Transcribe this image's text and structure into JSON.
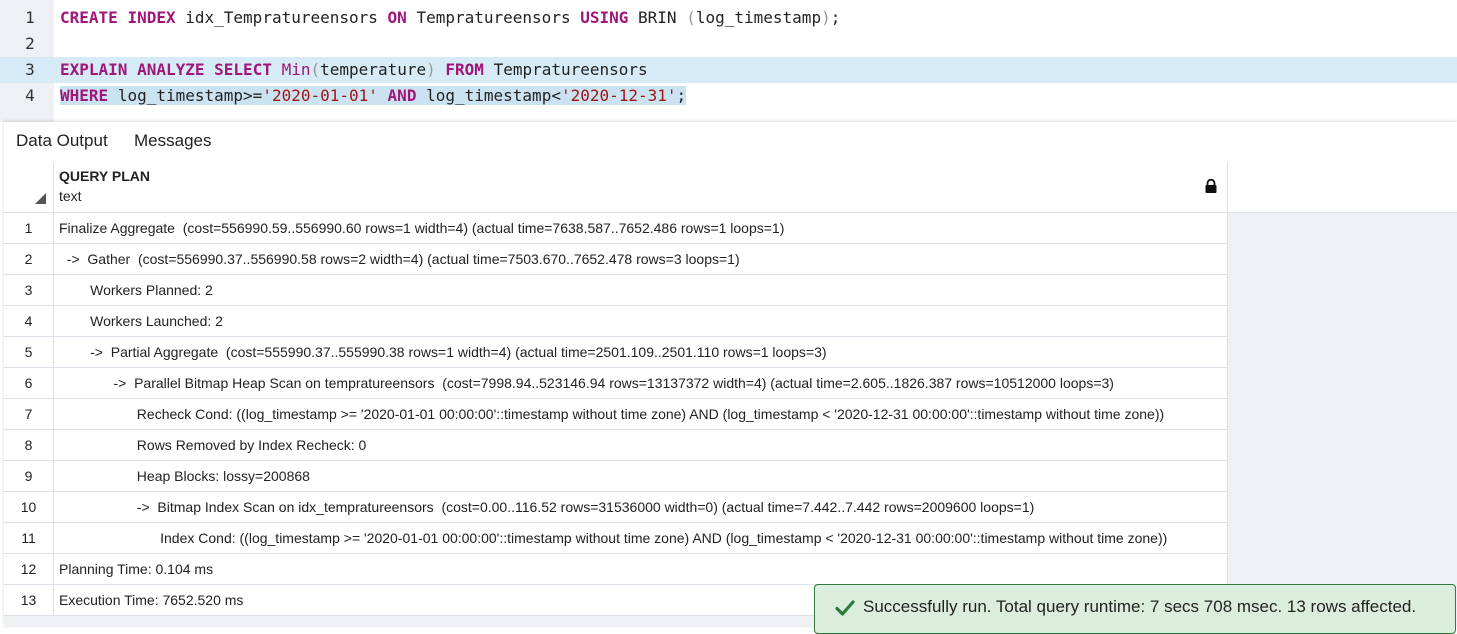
{
  "editor": {
    "lines": [
      {
        "num": "1",
        "tokens": [
          {
            "t": "CREATE INDEX",
            "c": "kw"
          },
          {
            "t": " idx_Tempratureensors ",
            "c": ""
          }
        ]
      },
      {
        "num": "2"
      },
      {
        "num": "3"
      },
      {
        "num": "4"
      }
    ],
    "line1": {
      "num": "1",
      "kw1": "CREATE",
      "kw2": "INDEX",
      "name": "idx_Tempratureensors",
      "kw3": "ON",
      "table": "Tempratureensors",
      "kw4": "USING",
      "method": "BRIN",
      "lp": "(",
      "col": "log_timestamp",
      "rp": ")",
      "end": ";"
    },
    "line2": {
      "num": "2"
    },
    "line3": {
      "num": "3",
      "kw1": "EXPLAIN",
      "kw2": "ANALYZE",
      "kw3": "SELECT",
      "fn": "Min",
      "lp": "(",
      "col": "temperature",
      "rp": ")",
      "kw4": "FROM",
      "table": "Tempratureensors"
    },
    "line4": {
      "num": "4",
      "kw1": "WHERE",
      "col1": "log_timestamp>=",
      "v1": "'2020-01-01'",
      "kw2": "AND",
      "col2": "log_timestamp<",
      "v2": "'2020-12-31'",
      "end": ";"
    }
  },
  "tabs": [
    "Data Output",
    "Messages"
  ],
  "grid": {
    "column": {
      "name": "QUERY PLAN",
      "type": "text"
    },
    "rows": [
      {
        "n": "1",
        "text": "Finalize Aggregate  (cost=556990.59..556990.60 rows=1 width=4) (actual time=7638.587..7652.486 rows=1 loops=1)"
      },
      {
        "n": "2",
        "text": "  ->  Gather  (cost=556990.37..556990.58 rows=2 width=4) (actual time=7503.670..7652.478 rows=3 loops=1)"
      },
      {
        "n": "3",
        "text": "        Workers Planned: 2"
      },
      {
        "n": "4",
        "text": "        Workers Launched: 2"
      },
      {
        "n": "5",
        "text": "        ->  Partial Aggregate  (cost=555990.37..555990.38 rows=1 width=4) (actual time=2501.109..2501.110 rows=1 loops=3)"
      },
      {
        "n": "6",
        "text": "              ->  Parallel Bitmap Heap Scan on tempratureensors  (cost=7998.94..523146.94 rows=13137372 width=4) (actual time=2.605..1826.387 rows=10512000 loops=3)"
      },
      {
        "n": "7",
        "text": "                    Recheck Cond: ((log_timestamp >= '2020-01-01 00:00:00'::timestamp without time zone) AND (log_timestamp < '2020-12-31 00:00:00'::timestamp without time zone))"
      },
      {
        "n": "8",
        "text": "                    Rows Removed by Index Recheck: 0"
      },
      {
        "n": "9",
        "text": "                    Heap Blocks: lossy=200868"
      },
      {
        "n": "10",
        "text": "                    ->  Bitmap Index Scan on idx_tempratureensors  (cost=0.00..116.52 rows=31536000 width=0) (actual time=7.442..7.442 rows=2009600 loops=1)"
      },
      {
        "n": "11",
        "text": "                          Index Cond: ((log_timestamp >= '2020-01-01 00:00:00'::timestamp without time zone) AND (log_timestamp < '2020-12-31 00:00:00'::timestamp without time zone))"
      },
      {
        "n": "12",
        "text": "Planning Time: 0.104 ms"
      },
      {
        "n": "13",
        "text": "Execution Time: 7652.520 ms"
      }
    ]
  },
  "toast": {
    "icon": "checkmark-icon",
    "message": "Successfully run. Total query runtime: 7 secs 708 msec. 13 rows affected.",
    "color": "#2d7a3e"
  }
}
